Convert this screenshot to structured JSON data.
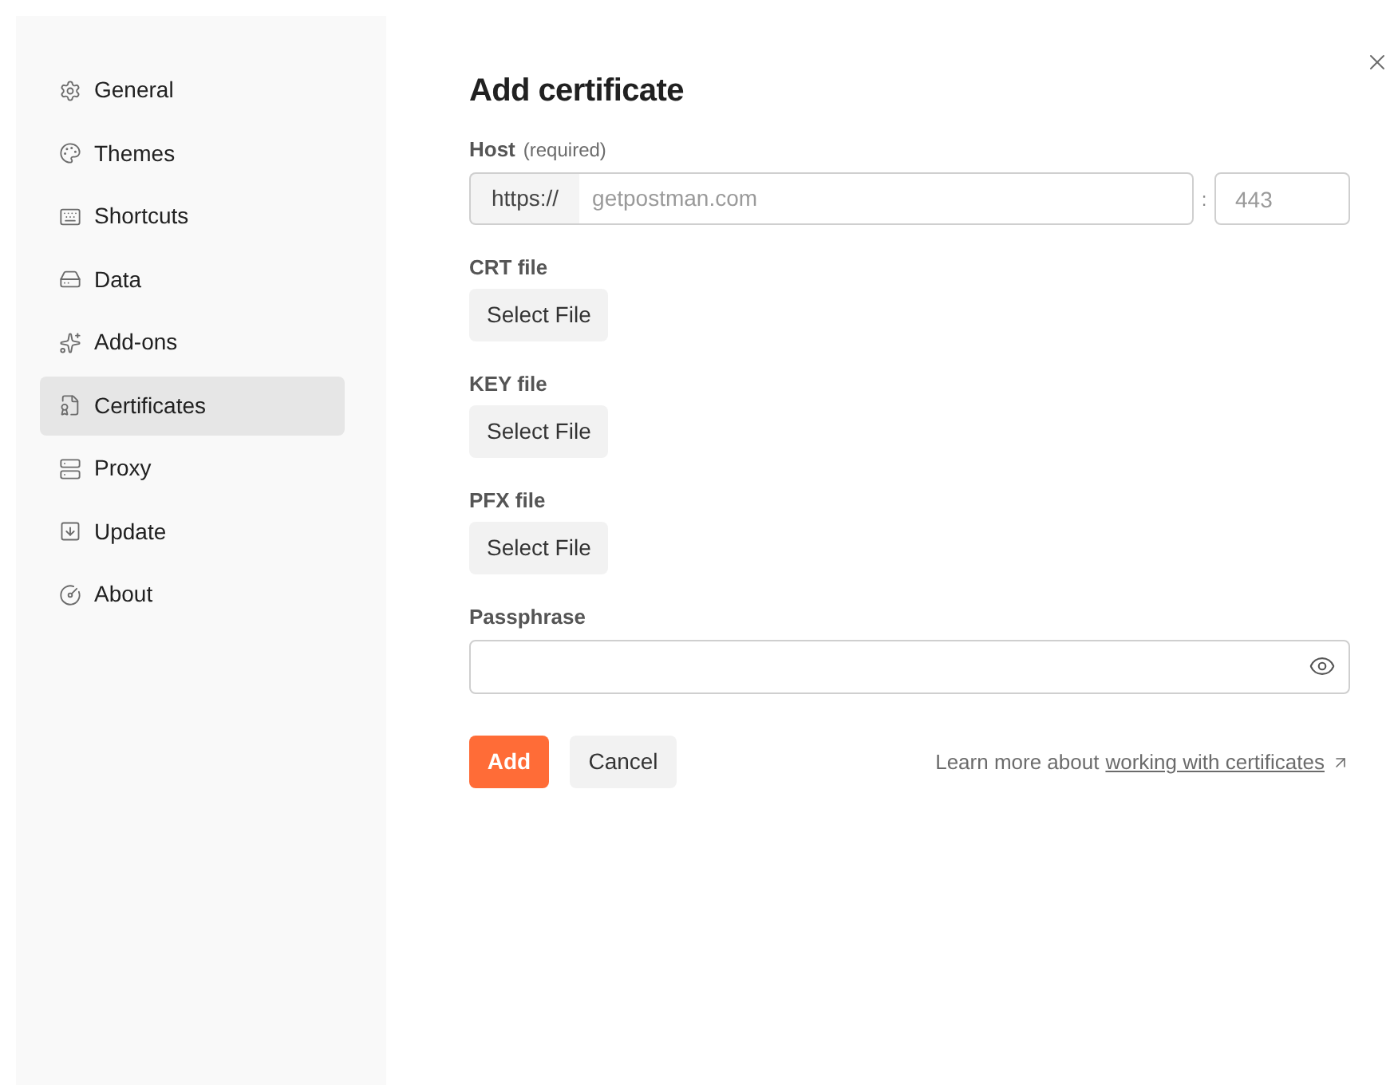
{
  "sidebar": {
    "items": [
      {
        "label": "General",
        "selected": false
      },
      {
        "label": "Themes",
        "selected": false
      },
      {
        "label": "Shortcuts",
        "selected": false
      },
      {
        "label": "Data",
        "selected": false
      },
      {
        "label": "Add-ons",
        "selected": false
      },
      {
        "label": "Certificates",
        "selected": true
      },
      {
        "label": "Proxy",
        "selected": false
      },
      {
        "label": "Update",
        "selected": false
      },
      {
        "label": "About",
        "selected": false
      }
    ]
  },
  "dialog": {
    "title": "Add certificate",
    "host": {
      "label": "Host",
      "hint": "(required)",
      "prefix": "https://",
      "placeholder": "getpostman.com",
      "separator": ":",
      "port_placeholder": "443"
    },
    "files": [
      {
        "label": "CRT file",
        "button": "Select File"
      },
      {
        "label": "KEY file",
        "button": "Select File"
      },
      {
        "label": "PFX file",
        "button": "Select File"
      }
    ],
    "passphrase": {
      "label": "Passphrase"
    },
    "buttons": {
      "primary": "Add",
      "secondary": "Cancel"
    },
    "help": {
      "text": "Learn more about",
      "link": "working with certificates"
    }
  }
}
